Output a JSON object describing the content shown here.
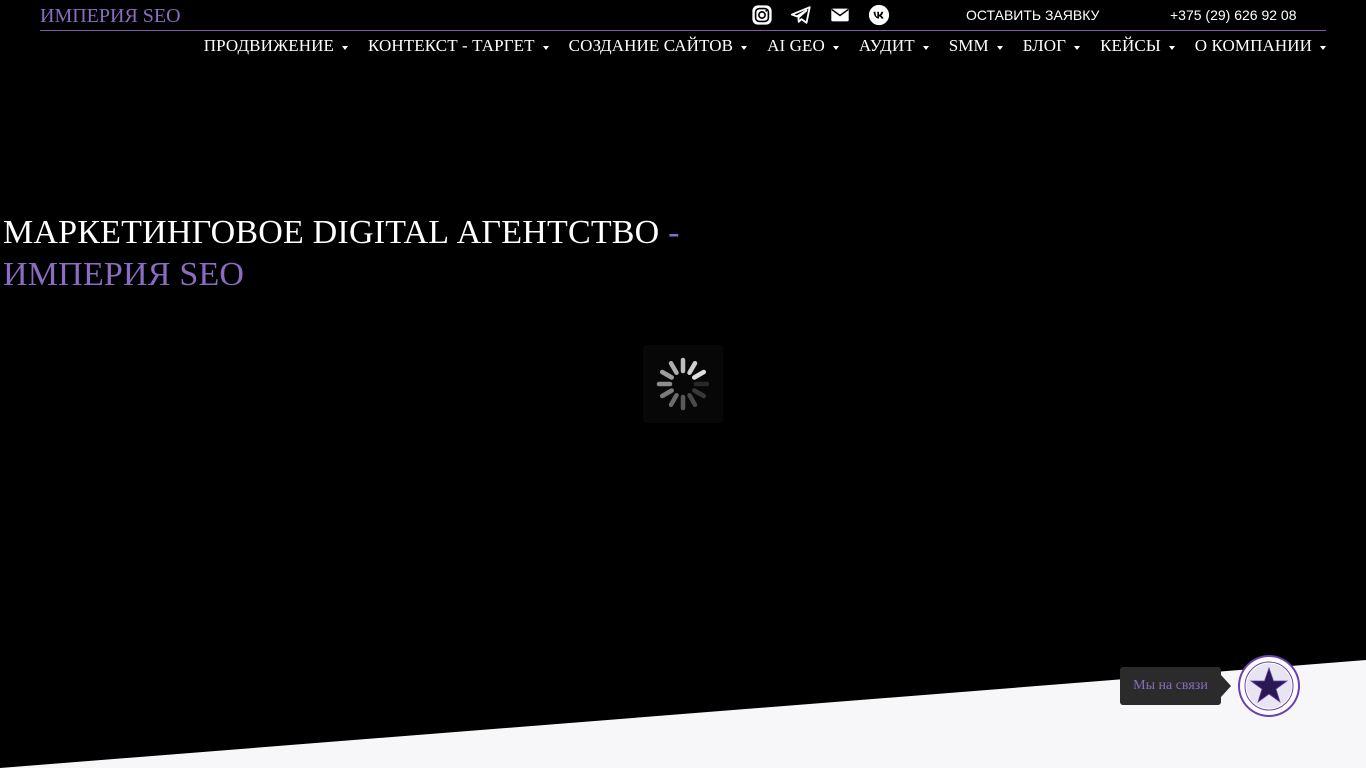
{
  "header": {
    "brand": "ИМПЕРИЯ SEO",
    "socials": [
      {
        "icon": "instagram-icon"
      },
      {
        "icon": "telegram-icon"
      },
      {
        "icon": "mail-icon"
      },
      {
        "icon": "vk-icon"
      }
    ],
    "cta_label": "ОСТАВИТЬ ЗАЯВКУ",
    "phone": "+375 (29) 626 92 08"
  },
  "nav": {
    "items": [
      {
        "label": "ПРОДВИЖЕНИЕ"
      },
      {
        "label": "КОНТЕКСТ - ТАРГЕТ"
      },
      {
        "label": "СОЗДАНИЕ САЙТОВ"
      },
      {
        "label": "AI GEO"
      },
      {
        "label": "АУДИТ"
      },
      {
        "label": "SMM"
      },
      {
        "label": "БЛОГ"
      },
      {
        "label": "КЕЙСЫ"
      },
      {
        "label": "О КОМПАНИИ"
      }
    ]
  },
  "hero": {
    "title_main": "МАРКЕТИНГОВОЕ DIGITAL АГЕНТСТВО",
    "title_accent": " - ИМПЕРИЯ SEO"
  },
  "chat": {
    "bubble_label": "Мы на связи"
  },
  "colors": {
    "background": "#000000",
    "accent": "#8a6cc0",
    "text": "#ffffff",
    "footer_band": "#f7f7f9"
  }
}
